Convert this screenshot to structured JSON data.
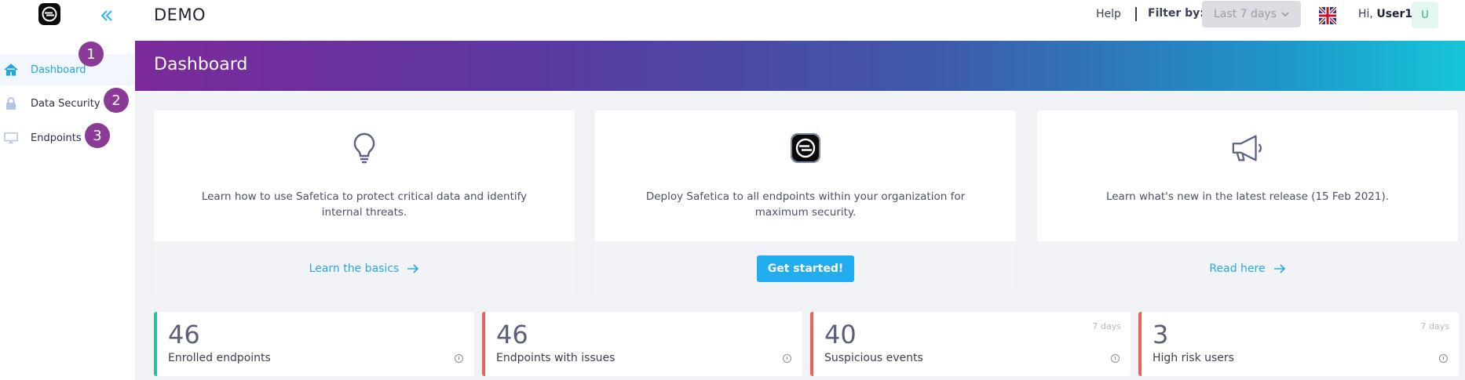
{
  "app": {
    "title": "DEMO"
  },
  "sidebar": {
    "items": [
      {
        "label": "Dashboard",
        "icon": "home-icon",
        "active": true,
        "step": "1"
      },
      {
        "label": "Data Security",
        "icon": "lock-icon",
        "active": false,
        "step": "2"
      },
      {
        "label": "Endpoints",
        "icon": "monitor-icon",
        "active": false,
        "step": "3"
      }
    ]
  },
  "topbar": {
    "help": "Help",
    "filter_label": "Filter by:",
    "filter_value": "Last 7 days",
    "greeting_prefix": "Hi,",
    "user": "User1",
    "avatar_initial": "U"
  },
  "banner": {
    "title": "Dashboard"
  },
  "cards": [
    {
      "icon": "lightbulb-icon",
      "text": "Learn how to use Safetica to protect critical data and identify internal threats.",
      "action": "Learn the basics"
    },
    {
      "icon": "safetica-logo-icon",
      "text": "Deploy Safetica to all endpoints within your organization for maximum security.",
      "action": "Get started!"
    },
    {
      "icon": "megaphone-icon",
      "text": "Learn what's new in the latest release (15 Feb 2021).",
      "action": "Read here"
    }
  ],
  "stats": [
    {
      "value": "46",
      "label": "Enrolled endpoints",
      "period": "",
      "color": "#2bbf9a"
    },
    {
      "value": "46",
      "label": "Endpoints with issues",
      "period": "",
      "color": "#f0605a"
    },
    {
      "value": "40",
      "label": "Suspicious events",
      "period": "7 days",
      "color": "#f0605a"
    },
    {
      "value": "3",
      "label": "High risk users",
      "period": "7 days",
      "color": "#f0605a"
    }
  ],
  "colors": {
    "accent": "#22adf0",
    "step_badge": "#8b3a98"
  }
}
